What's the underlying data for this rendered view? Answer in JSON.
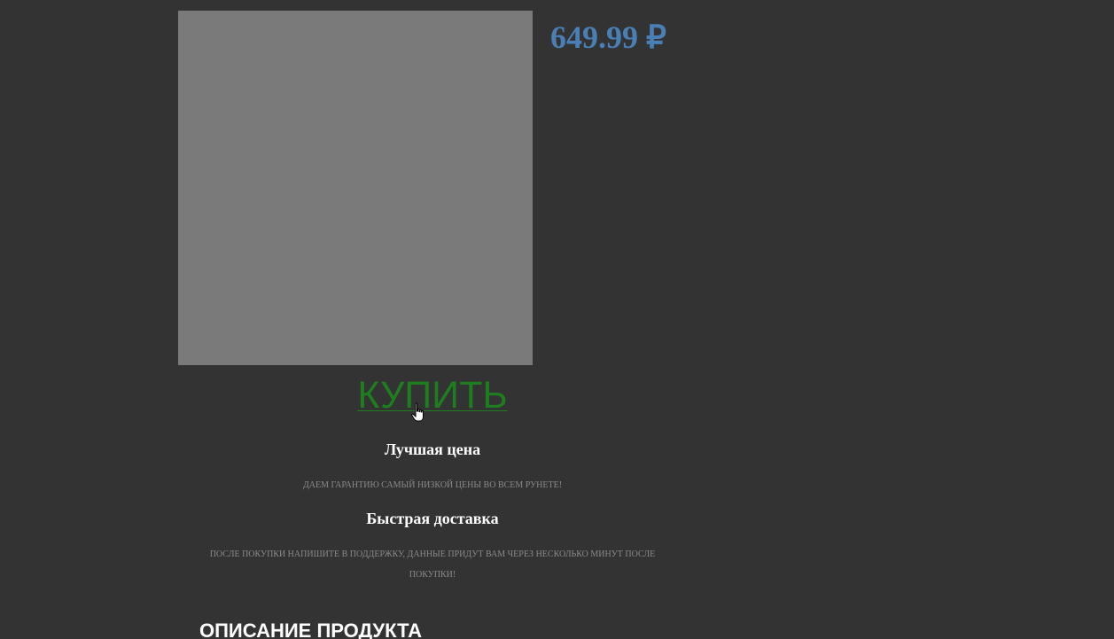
{
  "product": {
    "price": "649.99 ₽",
    "buy_label": "КУПИТЬ"
  },
  "features": [
    {
      "title": "Лучшая цена",
      "text": "ДАЕМ ГАРАНТИЮ САМЫЙ НИЗКОЙ ЦЕНЫ ВО ВСЕМ РУНЕТЕ!"
    },
    {
      "title": "Быстрая доставка",
      "text": "ПОСЛЕ ПОКУПКИ НАПИШИТЕ В ПОДДЕРЖКУ, ДАННЫЕ ПРИДУТ ВАМ ЧЕРЕЗ НЕСКОЛЬКО МИНУТ ПОСЛЕ ПОКУПКИ!"
    }
  ],
  "description": {
    "title": "ОПИСАНИЕ ПРОДУКТА"
  },
  "colors": {
    "background": "#333333",
    "price": "#4a7fb5",
    "buy_button": "#1e7d1e",
    "image_placeholder": "#7a7a7a"
  },
  "icons": {
    "cursor": "hand-pointer-icon"
  }
}
